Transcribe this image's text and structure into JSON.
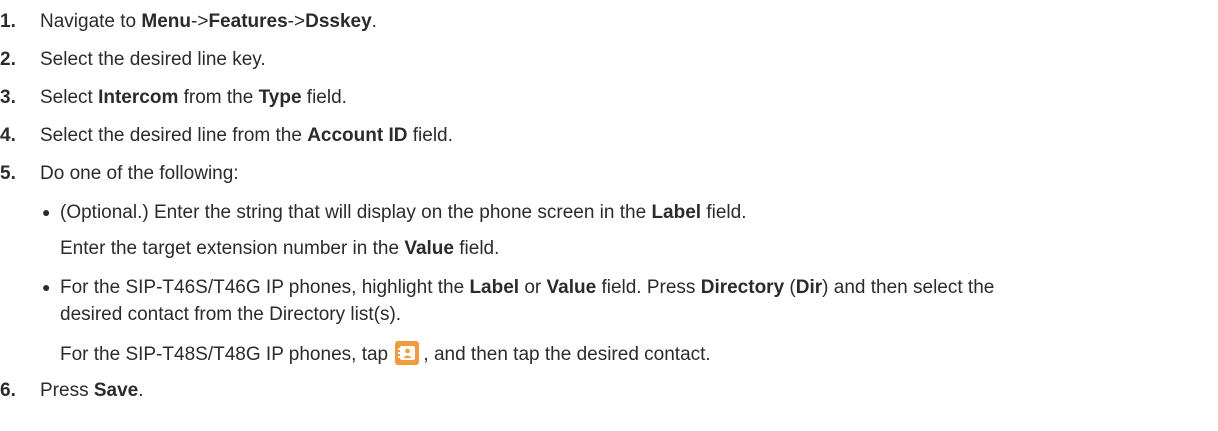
{
  "steps": [
    {
      "num": "1.",
      "parts": [
        "Navigate to ",
        "Menu",
        "->",
        "Features",
        "->",
        "Dsskey",
        "."
      ]
    },
    {
      "num": "2.",
      "text": "Select the desired line key."
    },
    {
      "num": "3.",
      "parts": [
        "Select ",
        "Intercom",
        " from the ",
        "Type",
        " field."
      ]
    },
    {
      "num": "4.",
      "parts": [
        "Select the desired line from the ",
        "Account ID",
        " field."
      ]
    },
    {
      "num": "5.",
      "text": "Do one of the following:",
      "bullets": [
        {
          "parts": [
            "(Optional.) Enter the string that will display on the phone screen in the ",
            "Label",
            " field."
          ],
          "continuation": [
            "Enter the target extension number in the ",
            "Value",
            " field."
          ]
        },
        {
          "parts": [
            "For the SIP-T46S/T46G IP phones, highlight the ",
            "Label",
            " or ",
            "Value",
            " field. Press ",
            "Directory",
            " (",
            "Dir",
            ") and then select the"
          ],
          "wrap": "desired contact from the Directory list(s).",
          "continuation": [
            "For the SIP-T48S/T48G IP phones, tap ",
            ", and then tap the desired contact."
          ],
          "icon": "contact-directory-icon"
        }
      ]
    },
    {
      "num": "6.",
      "parts": [
        "Press ",
        "Save",
        "."
      ]
    }
  ],
  "colors": {
    "text": "#2b2b2b",
    "icon_bg": "#f39a3c",
    "icon_fg": "#ffffff"
  }
}
